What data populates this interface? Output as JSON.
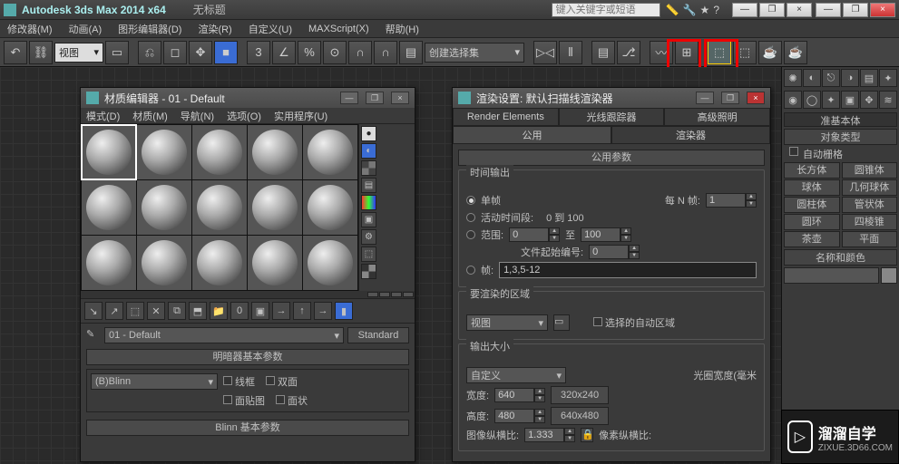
{
  "app": {
    "title": "Autodesk 3ds Max  2014 x64",
    "doc": "无标题",
    "searchPlaceholder": "键入关键字或短语"
  },
  "mainmenu": [
    "修改器(M)",
    "动画(A)",
    "图形编辑器(D)",
    "渲染(R)",
    "自定义(U)",
    "MAXScript(X)",
    "帮助(H)"
  ],
  "toolbar": {
    "viewportCombo": "视图",
    "createSetCombo": "创建选择集"
  },
  "materialEditor": {
    "title": "材质编辑器 - 01 - Default",
    "menu": [
      "模式(D)",
      "材质(M)",
      "导航(N)",
      "选项(O)",
      "实用程序(U)"
    ],
    "currentMaterial": "01 - Default",
    "standardBtn": "Standard",
    "rollout1": "明暗器基本参数",
    "shaderCombo": "(B)Blinn",
    "chk_wire": "线框",
    "chk_2side": "双面",
    "chk_facemap": "面贴图",
    "chk_faceted": "面状",
    "rollout2": "Blinn 基本参数"
  },
  "renderSetup": {
    "title": "渲染设置: 默认扫描线渲染器",
    "tabs_top": [
      "Render Elements",
      "光线跟踪器",
      "高级照明"
    ],
    "tabs_bottom": [
      "公用",
      "渲染器"
    ],
    "group_common": "公用参数",
    "group_time": "时间输出",
    "radio_single": "单帧",
    "label_everyN": "每 N 帧:",
    "everyN": "1",
    "radio_active": "活动时间段:",
    "activeRange": "0 到 100",
    "radio_range": "范围:",
    "range_from": "0",
    "range_to_label": "至",
    "range_to": "100",
    "label_filestart": "文件起始编号:",
    "filestart": "0",
    "radio_frames": "帧:",
    "framesText": "1,3,5-12",
    "group_area": "要渲染的区域",
    "areaCombo": "视图",
    "chk_autoArea": "选择的自动区域",
    "group_output": "输出大小",
    "outputCombo": "自定义",
    "label_aperture": "光圈宽度(毫米",
    "label_width": "宽度:",
    "width": "640",
    "label_height": "高度:",
    "height": "480",
    "preset1": "320x240",
    "preset2": "640x480",
    "label_aspect": "图像纵横比:",
    "aspect": "1.333",
    "label_pixelAspect": "像素纵横比:"
  },
  "cmdpanel": {
    "category": "准基本体",
    "section_type": "对象类型",
    "chk_autogrid": "自动栅格",
    "buttons": [
      [
        "长方体",
        "圆锥体"
      ],
      [
        "球体",
        "几何球体"
      ],
      [
        "圆柱体",
        "管状体"
      ],
      [
        "圆环",
        "四棱锥"
      ],
      [
        "茶壶",
        "平面"
      ]
    ],
    "section_name": "名称和颜色"
  },
  "watermark": {
    "brand": "溜溜自学",
    "url": "ZIXUE.3D66.COM"
  }
}
